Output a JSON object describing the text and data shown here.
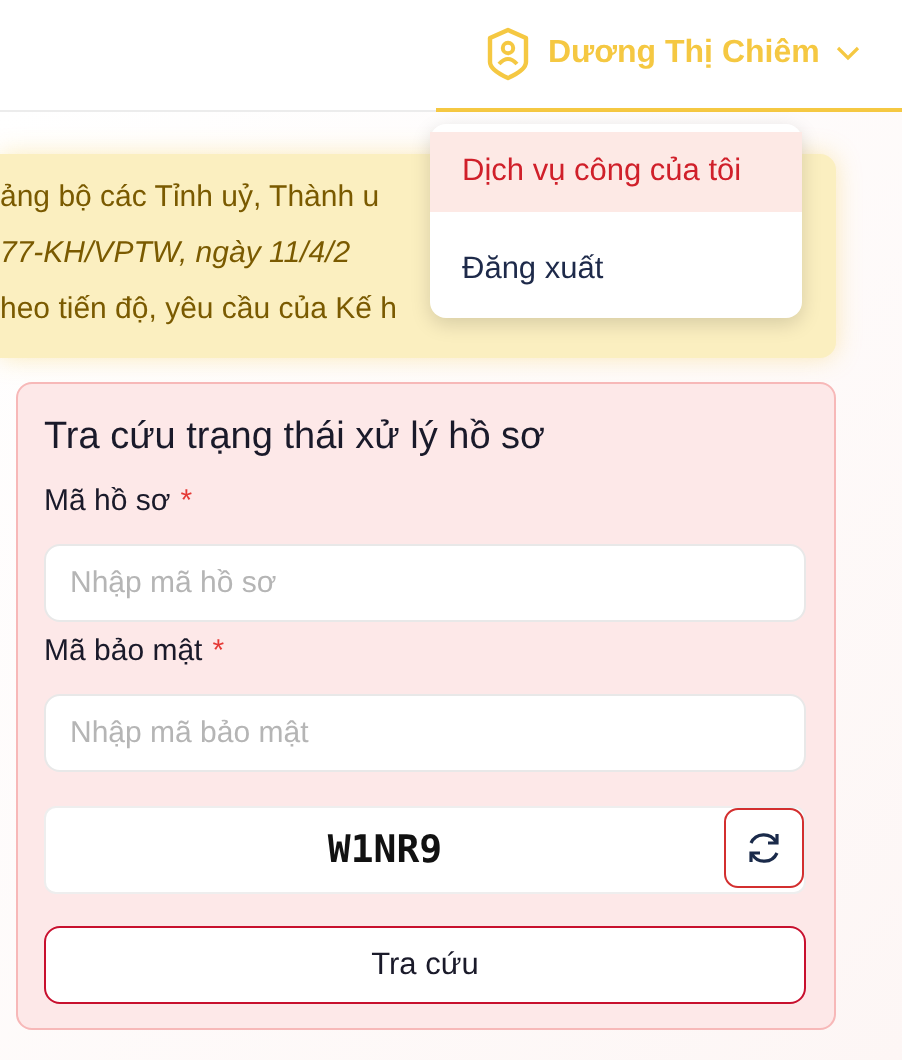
{
  "user_menu": {
    "name": "Dương Thị Chiêm",
    "items": [
      {
        "label": "Dịch vụ công của tôi",
        "selected": true
      },
      {
        "label": "Đăng xuất",
        "selected": false
      }
    ]
  },
  "notice": {
    "lines": [
      {
        "text": "ảng bộ các Tỉnh uỷ, Thành u",
        "italic": false
      },
      {
        "text": "77-KH/VPTW, ngày 11/4/2",
        "italic": true
      },
      {
        "text": "heo tiến độ, yêu cầu của Kế h",
        "italic": false
      }
    ]
  },
  "lookup_form": {
    "title": "Tra cứu trạng thái xử lý hồ sơ",
    "fields": [
      {
        "label": "Mã hồ sơ",
        "required_mark": "*",
        "placeholder": "Nhập mã hồ sơ"
      },
      {
        "label": "Mã bảo mật",
        "required_mark": "*",
        "placeholder": "Nhập mã bảo mật"
      }
    ],
    "captcha": "W1NR9",
    "submit": "Tra cứu"
  }
}
